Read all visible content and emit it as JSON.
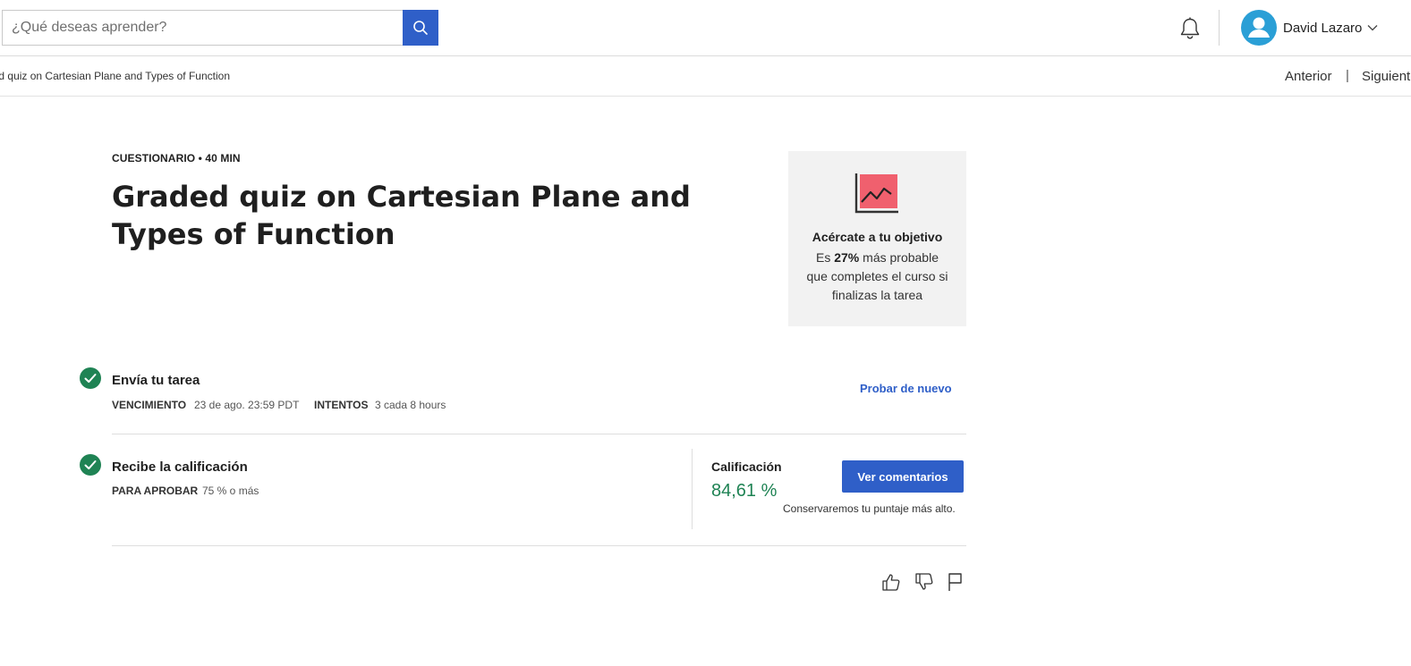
{
  "header": {
    "search": {
      "placeholder": "¿Qué deseas aprender?",
      "value": ""
    },
    "user": {
      "name": "David Lazaro"
    }
  },
  "breadcrumb": {
    "title": "Graded quiz on Cartesian Plane and Types of Function",
    "prev_label": "Anterior",
    "separator": "|",
    "next_label": "Siguiente"
  },
  "main": {
    "kicker": "CUESTIONARIO • 40 MIN",
    "title": "Graded quiz on Cartesian Plane and Types of Function"
  },
  "goal_card": {
    "title": "Acércate a tu objetivo",
    "text_prefix": "Es ",
    "percent": "27%",
    "text_suffix": " más probable que completes el curso si finalizas la tarea"
  },
  "steps": {
    "submit": {
      "title": "Envía tu tarea",
      "due_label": "VENCIMIENTO",
      "due_value": "23 de ago. 23:59 PDT",
      "attempts_label": "INTENTOS",
      "attempts_value": "3 cada 8 hours",
      "retry_label": "Probar de nuevo"
    },
    "grade": {
      "title": "Recibe la calificación",
      "pass_label": "PARA APROBAR",
      "pass_value": "75 % o más",
      "grade_label": "Calificación",
      "grade_value": "84,61 %",
      "feedback_button": "Ver comentarios",
      "keep_note": "Conservaremos tu puntaje más alto."
    }
  },
  "colors": {
    "primary": "#2f5fc8",
    "success": "#1f8354",
    "goal_icon": "#f0606e",
    "avatar": "#2a9fd6"
  },
  "icons": [
    "search-icon",
    "bell-icon",
    "user-avatar-icon",
    "chevron-down-icon",
    "trend-chart-icon",
    "check-icon",
    "thumbs-up-icon",
    "thumbs-down-icon",
    "flag-icon"
  ]
}
